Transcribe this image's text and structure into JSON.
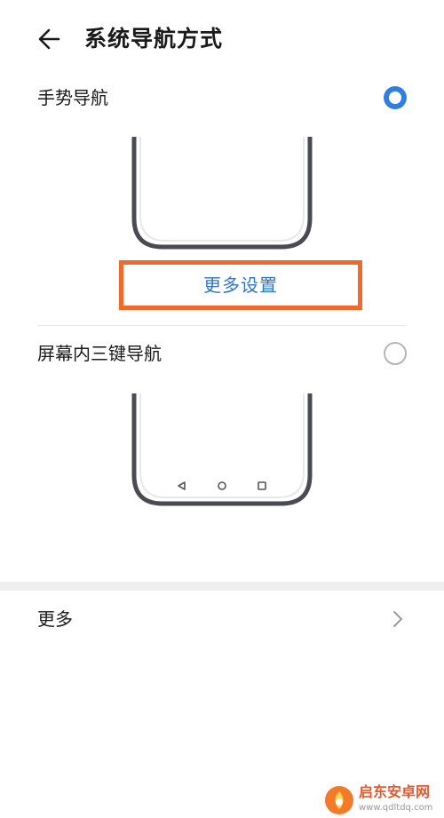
{
  "header": {
    "title": "系统导航方式",
    "back_icon": "arrow-left-icon"
  },
  "options": [
    {
      "label": "手势导航",
      "selected": true,
      "more_settings_label": "更多设置"
    },
    {
      "label": "屏幕内三键导航",
      "selected": false,
      "nav_icons": [
        "back-triangle-icon",
        "home-circle-icon",
        "recents-square-icon"
      ]
    }
  ],
  "more": {
    "label": "更多",
    "chevron_icon": "chevron-right-icon"
  },
  "watermark": {
    "brand": "启东安卓网",
    "url": "www.qdltdq.com"
  },
  "colors": {
    "accent": "#2f7fe0",
    "link": "#2f75c6",
    "highlight_border": "#ef6a2b",
    "phone_frame": "#4a4a52"
  }
}
